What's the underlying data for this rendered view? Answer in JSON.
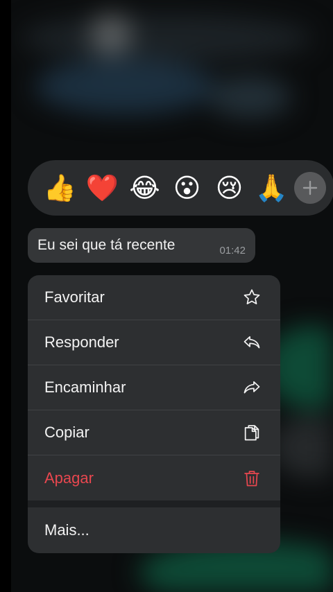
{
  "reactions": [
    {
      "emoji": "👍",
      "name": "thumbs-up"
    },
    {
      "emoji": "❤️",
      "name": "heart"
    },
    {
      "emoji": "😂",
      "name": "tears-of-joy"
    },
    {
      "emoji": "😮",
      "name": "surprised"
    },
    {
      "emoji": "😢",
      "name": "crying"
    },
    {
      "emoji": "🙏",
      "name": "folded-hands"
    }
  ],
  "message": {
    "text": "Eu sei que tá recente",
    "time": "01:42"
  },
  "menu": {
    "favorite": {
      "label": "Favoritar",
      "icon": "star-icon"
    },
    "reply": {
      "label": "Responder",
      "icon": "reply-icon"
    },
    "forward": {
      "label": "Encaminhar",
      "icon": "forward-icon"
    },
    "copy": {
      "label": "Copiar",
      "icon": "copy-icon"
    },
    "delete": {
      "label": "Apagar",
      "icon": "trash-icon",
      "color": "#e8474f"
    },
    "more": {
      "label": "Mais..."
    }
  }
}
